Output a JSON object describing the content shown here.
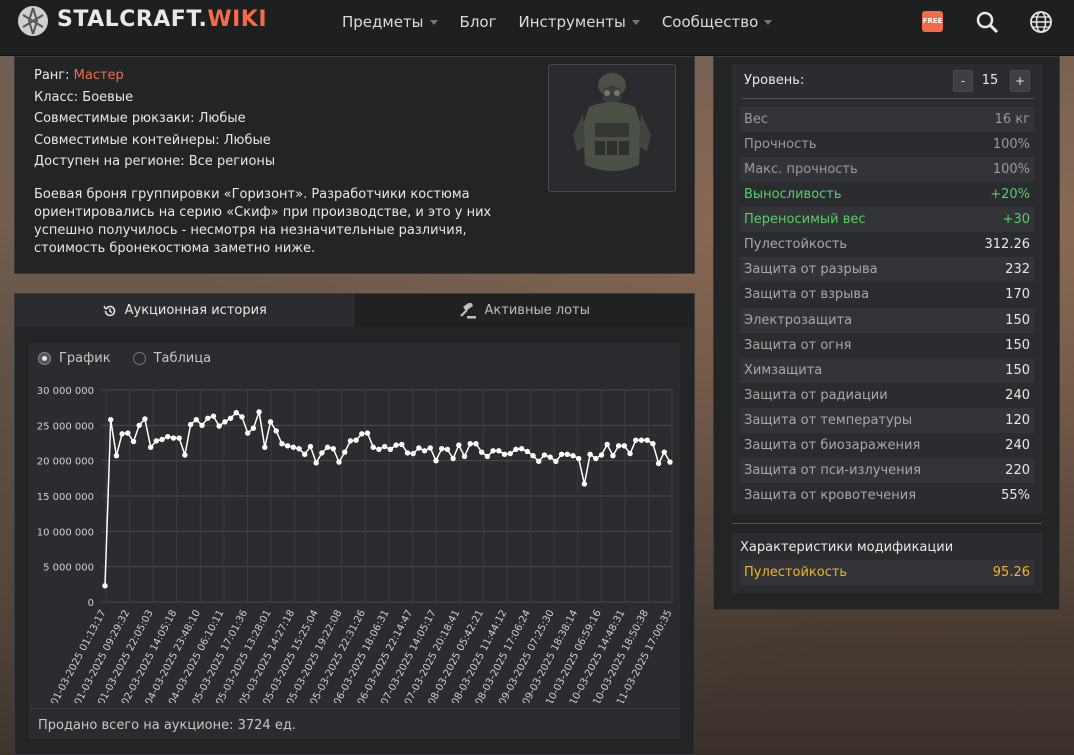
{
  "header": {
    "logo_main": "STALCRAFT.",
    "logo_accent": "WIKI",
    "nav": [
      {
        "label": "Предметы",
        "has_dropdown": true
      },
      {
        "label": "Блог",
        "has_dropdown": false
      },
      {
        "label": "Инструменты",
        "has_dropdown": true
      },
      {
        "label": "Сообщество",
        "has_dropdown": true
      }
    ],
    "free_badge": "FREE",
    "icons": [
      "logo-icon",
      "free-icon",
      "search-icon",
      "globe-icon"
    ]
  },
  "item": {
    "rank_label": "Ранг:",
    "rank_value": "Мастер",
    "class_line": "Класс: Боевые",
    "backpacks_line": "Совместимые рюкзаки: Любые",
    "containers_line": "Совместимые контейнеры: Любые",
    "region_line": "Доступен на регионе: Все регионы",
    "description": "Боевая броня группировки «Горизонт». Разработчики костюма ориентировались на серию «Скиф» при производстве, и это у них успешно получилось - несмотря на незначительные различия, стоимость бронекостюма заметно ниже."
  },
  "history": {
    "tabs": [
      {
        "label": "Аукционная история",
        "active": true,
        "icon": "history-icon"
      },
      {
        "label": "Активные лоты",
        "active": false,
        "icon": "gavel-icon"
      }
    ],
    "view_options": [
      {
        "label": "График",
        "selected": true
      },
      {
        "label": "Таблица",
        "selected": false
      }
    ],
    "sold_text": "Продано всего на аукционе: 3724 ед."
  },
  "chart_data": {
    "type": "line",
    "ylim": [
      0,
      30000000
    ],
    "y_ticks": [
      "0",
      "5 000 000",
      "10 000 000",
      "15 000 000",
      "20 000 000",
      "25 000 000",
      "30 000 000"
    ],
    "x_labels": [
      "01-03-2025 01:13:17",
      "01-03-2025 09:29:32",
      "01-03-2025 22:05:03",
      "02-03-2025 14:05:18",
      "04-03-2025 23:48:10",
      "04-03-2025 06:10:11",
      "05-03-2025 17:01:36",
      "05-03-2025 13:28:01",
      "05-03-2025 14:27:18",
      "05-03-2025 15:25:04",
      "05-03-2025 19:22:08",
      "05-03-2025 22:31:26",
      "06-03-2025 18:06:31",
      "06-03-2025 22:14:47",
      "07-03-2025 14:05:17",
      "07-03-2025 20:18:41",
      "08-03-2025 05:42:21",
      "08-03-2025 11:44:12",
      "08-03-2025 17:06:24",
      "09-03-2025 07:25:30",
      "09-03-2025 18:38:14",
      "10-03-2025 06:59:16",
      "10-03-2025 14:48:31",
      "10-03-2025 18:50:38",
      "11-03-2025 17:00:35"
    ],
    "values": [
      2300000,
      25800000,
      20700000,
      23800000,
      23900000,
      22700000,
      25000000,
      25900000,
      21900000,
      22800000,
      23000000,
      23400000,
      23200000,
      23200000,
      20800000,
      25100000,
      25800000,
      25000000,
      26000000,
      26300000,
      24900000,
      25500000,
      26000000,
      26800000,
      26200000,
      23900000,
      24600000,
      26900000,
      21900000,
      25500000,
      24200000,
      22400000,
      22100000,
      21900000,
      21700000,
      20900000,
      22000000,
      19700000,
      21100000,
      21900000,
      21700000,
      19800000,
      21200000,
      22800000,
      22900000,
      23800000,
      23900000,
      21900000,
      21600000,
      22000000,
      21600000,
      22200000,
      22300000,
      21100000,
      21000000,
      21800000,
      21400000,
      21800000,
      20000000,
      21700000,
      21600000,
      20300000,
      22200000,
      20600000,
      22400000,
      22400000,
      21200000,
      20600000,
      21400000,
      21400000,
      20900000,
      21000000,
      21600000,
      21700000,
      21300000,
      20700000,
      19900000,
      20800000,
      20500000,
      19900000,
      20900000,
      20900000,
      20700000,
      20300000,
      16700000,
      20900000,
      20300000,
      20800000,
      22300000,
      20700000,
      22100000,
      22100000,
      21000000,
      22900000,
      22900000,
      22900000,
      22400000,
      19600000,
      21200000,
      19800000
    ]
  },
  "stats": {
    "level_label": "Уровень:",
    "level_minus": "-",
    "level_value": "15",
    "level_plus": "+",
    "rows": [
      {
        "name": "Вес",
        "value": "16 кг",
        "style": "muted"
      },
      {
        "name": "Прочность",
        "value": "100%",
        "style": "muted"
      },
      {
        "name": "Макс. прочность",
        "value": "100%",
        "style": "muted"
      },
      {
        "name": "Выносливость",
        "value": "+20%",
        "style": "green"
      },
      {
        "name": "Переносимый вес",
        "value": "+30",
        "style": "green"
      },
      {
        "name": "Пулестойкость",
        "value": "312.26",
        "style": "normal"
      },
      {
        "name": "Защита от разрыва",
        "value": "232",
        "style": "normal"
      },
      {
        "name": "Защита от взрыва",
        "value": "170",
        "style": "normal"
      },
      {
        "name": "Электрозащита",
        "value": "150",
        "style": "normal"
      },
      {
        "name": "Защита от огня",
        "value": "150",
        "style": "normal"
      },
      {
        "name": "Химзащита",
        "value": "150",
        "style": "normal"
      },
      {
        "name": "Защита от радиации",
        "value": "240",
        "style": "normal"
      },
      {
        "name": "Защита от температуры",
        "value": "120",
        "style": "normal"
      },
      {
        "name": "Защита от биозаражения",
        "value": "240",
        "style": "normal"
      },
      {
        "name": "Защита от пси-излучения",
        "value": "220",
        "style": "normal"
      },
      {
        "name": "Защита от кровотечения",
        "value": "55%",
        "style": "normal"
      }
    ],
    "mod_title": "Характеристики модификации",
    "mod_row": {
      "name": "Пулестойкость",
      "value": "95.26"
    }
  },
  "colors": {
    "accent": "#f36b4a",
    "green": "#56d064",
    "mod": "#f0b429",
    "panel": "#232426"
  }
}
